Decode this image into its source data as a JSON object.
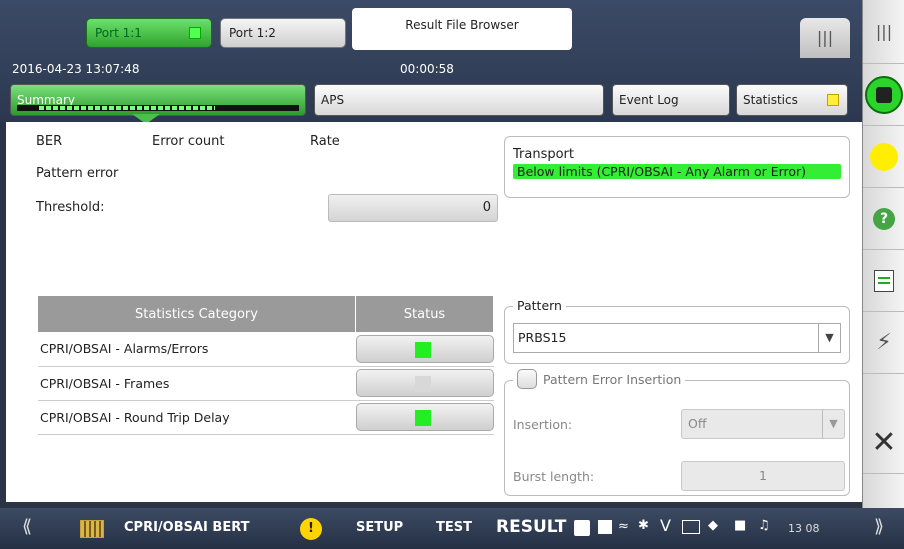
{
  "header": {
    "ports": [
      {
        "label": "Port 1:1",
        "active": true
      },
      {
        "label": "Port 1:2",
        "active": false
      }
    ],
    "result_browser": "Result File Browser",
    "datetime": "2016-04-23 13:07:48",
    "timer": "00:00:58",
    "menu_icon": "|||"
  },
  "tabs": {
    "summary": "Summary",
    "aps": "APS",
    "event_log": "Event Log",
    "statistics": "Statistics"
  },
  "ber": {
    "col_ber": "BER",
    "col_error_count": "Error count",
    "col_rate": "Rate",
    "pattern_error": "Pattern error",
    "threshold_label": "Threshold:",
    "threshold_value": "0"
  },
  "transport": {
    "title": "Transport",
    "status": "Below limits (CPRI/OBSAI - Any Alarm or Error)",
    "status_color": "#33ee33"
  },
  "stats_table": {
    "headers": [
      "Statistics Category",
      "Status"
    ],
    "rows": [
      {
        "category": "CPRI/OBSAI - Alarms/Errors",
        "status_color": "#22ee22"
      },
      {
        "category": "CPRI/OBSAI - Frames",
        "status_color": "#d8d8d8"
      },
      {
        "category": "CPRI/OBSAI - Round Trip Delay",
        "status_color": "#22ee22"
      }
    ]
  },
  "pattern": {
    "legend": "Pattern",
    "value": "PRBS15"
  },
  "pattern_error_insertion": {
    "legend": "Pattern Error Insertion",
    "insertion_label": "Insertion:",
    "insertion_value": "Off",
    "burst_label": "Burst length:",
    "burst_value": "1"
  },
  "side_panel": {
    "menu_icon": "|||",
    "icons": [
      "stop-icon",
      "status-led-icon",
      "help-icon",
      "report-icon",
      "lightning-icon",
      "close-icon"
    ]
  },
  "bottom_bar": {
    "app_name": "CPRI/OBSAI BERT",
    "setup": "SETUP",
    "test": "TEST",
    "result": "RESULT",
    "time_short": "13 08",
    "left_chevron": "⟪",
    "right_chevron": "⟫"
  }
}
